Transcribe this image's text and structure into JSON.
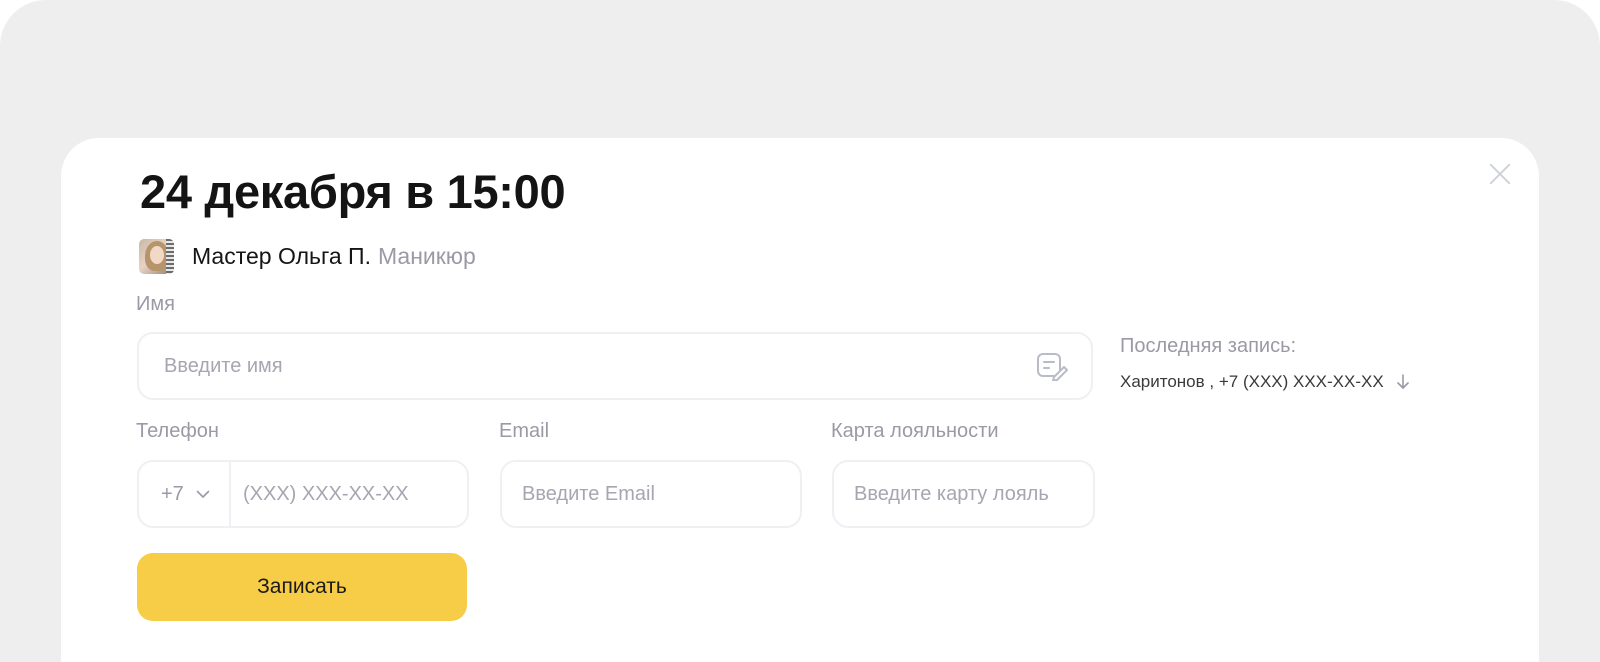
{
  "modal": {
    "title": "24 декабря в 15:00",
    "master_name": "Мастер Ольга П.",
    "service": "Маникюр"
  },
  "form": {
    "name": {
      "label": "Имя",
      "placeholder": "Введите имя"
    },
    "phone": {
      "label": "Телефон",
      "country_code": "+7",
      "placeholder": "(XXX) XXX-XX-XX"
    },
    "email": {
      "label": "Email",
      "placeholder": "Введите Email"
    },
    "loyalty": {
      "label": "Карта лояльности",
      "placeholder": "Введите карту лояль"
    },
    "submit_label": "Записать"
  },
  "last_record": {
    "label": "Последняя запись:",
    "value": "Харитонов , +7 (XXX) XXX-XX-XX"
  },
  "colors": {
    "accent": "#f7cc47",
    "muted_text": "#9a9aa6",
    "field_border": "#eff0f4",
    "backdrop": "#eeeeee"
  },
  "icons": [
    "close-icon",
    "edit-note-icon",
    "chevron-down-icon",
    "arrow-down-icon"
  ]
}
